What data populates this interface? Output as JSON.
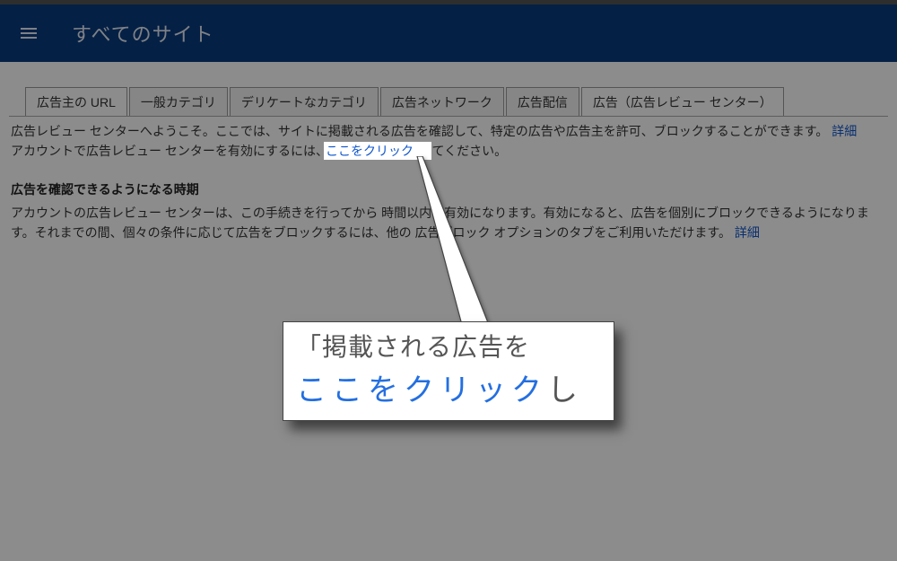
{
  "header": {
    "title": "すべてのサイト"
  },
  "tabs": [
    {
      "label": "広告主の URL"
    },
    {
      "label": "一般カテゴリ"
    },
    {
      "label": "デリケートなカテゴリ"
    },
    {
      "label": "広告ネットワーク"
    },
    {
      "label": "広告配信"
    },
    {
      "label": "広告（広告レビュー センター）"
    }
  ],
  "intro": {
    "line1_pre": "広告レビュー センターへようこそ。ここでは、サイトに掲載される広告を確認して、特定の広告や広告主を許可、ブロックすることができます。",
    "line1_link": "詳細",
    "line2_pre": "アカウントで広告レビュー センターを有効にするには、",
    "line2_link": "ここをクリック",
    "line2_post": "してください。"
  },
  "section": {
    "heading": "広告を確認できるようになる時期",
    "body_pre": "アカウントの広告レビュー センターは、この手続きを行ってから 時間以内に有効になります。有効になると、広告を個別にブロックできるようになります。それまでの間、個々の条件に応じて広告をブロックするには、他の 広告ブロック オプションのタブをご利用いただけます。",
    "body_link": "詳細"
  },
  "callout": {
    "line1": "「掲載される広告を",
    "line2_main": "ここをクリック",
    "line2_trail": "し"
  },
  "highlight": {
    "text": "ここをクリック"
  }
}
